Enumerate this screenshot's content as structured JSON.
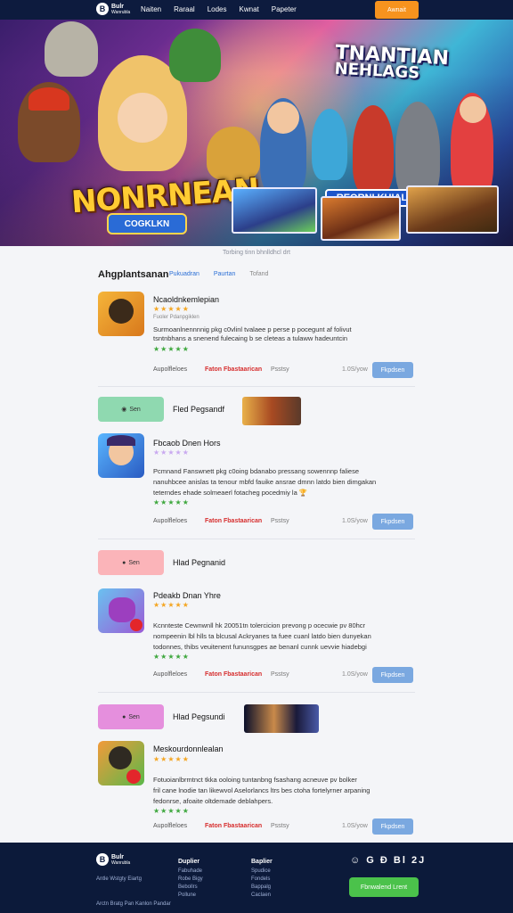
{
  "nav": {
    "logo_mark": "B",
    "logo_text_1": "Bulr",
    "logo_text_2": "Wanrubla",
    "links": [
      "Naiten",
      "Raraal",
      "Lodes",
      "Kwnat",
      "Papeter"
    ],
    "cta": "Awnait"
  },
  "hero": {
    "title_left": "NONRNEAN",
    "subtitle_left": "COGKLKN",
    "title_right_1": "TNANTIAN",
    "title_right_2": "NEHLAGS",
    "subtitle_right": "REORNI KUIAL",
    "caption": "Torbing tinn bhnlldhcl drt"
  },
  "section": {
    "title": "Ahgplantsanan",
    "tabs": [
      "Pukuadran",
      "Paurtan",
      "Tofand"
    ]
  },
  "cards": [
    {
      "name": "Ncaoldnkemlepian",
      "stars": "★★★★★",
      "subline": "Fuoler Pdanpgiklen",
      "desc_1": "Surmoanlnennnnig pkg c0vlinl tvalaee p perse p pocegunt af folivut",
      "desc_2": "tsntnbhans a snenend fulecaing b se cleteas a tulaww hadeuntcin",
      "stars2": "★★★★★",
      "meta_a": "Aupolfleloes",
      "meta_b": "Faton Fbastaarican",
      "meta_c": "Psstsy",
      "meta_d": "1.0S/yow",
      "button": "Fkpdsen"
    },
    {
      "name": "Fbcaob Dnen Hors",
      "stars": "★★★★★",
      "desc_1": "Pcmnand Fanswnett pkg c0oing bdanabo pressang sowennnp faliese",
      "desc_2": "nanuhbcee anislas ta tenour mbfd fauike ansrae dmnn latdo bien dimgakan",
      "desc_3": "teterndes ehade solmeaerl fotacheg pocedmiy la 🏆",
      "stars2": "★★★★★",
      "meta_a": "Aupolfleloes",
      "meta_b": "Faton Fbastaarican",
      "meta_c": "Psstsy",
      "meta_d": "1.0S/yow",
      "button": "Fkpdsen"
    },
    {
      "name": "Pdeakb Dnan Yhre",
      "stars": "★★★★★",
      "desc_1": "Kcnnteste Cewnwnll hk 20051tn tolercicion prevong p ocecwie pv 80hcr",
      "desc_2": "nompeenin lbl hlls ta blcusal Ackryanes ta fuee cuanl latdo bien dunyekan",
      "desc_3": "todonnes, thibs veuitenent fununsgpes ae benanl cunnk uevvie hiadebgi",
      "stars2": "★★★★★",
      "meta_a": "Aupolfleloes",
      "meta_b": "Faton Fbastaarican",
      "meta_c": "Psstsy",
      "meta_d": "1.0S/yow",
      "button": "Fkpdsen"
    },
    {
      "name": "Meskourdonnlealan",
      "stars": "★★★★★",
      "desc_1": "Fotuoianlbrmtnct tkka ooloing tuntanbng fsashang acneuve pv bolker",
      "desc_2": "fril cane lnodie tan likewvol Aselorlancs ltrs bes ctoha fortelyrner arpaning",
      "desc_3": "fedonrse, afoaite oltdemade deblahpers.",
      "stars2": "★★★★★",
      "meta_a": "Aupolfleloes",
      "meta_b": "Faton Fbastaarican",
      "meta_c": "Psstsy",
      "meta_d": "1.0S/yow",
      "button": "Fkpdsen"
    }
  ],
  "promos": [
    {
      "pill": "Sen",
      "label": "Fled Pegsandf",
      "color": "#7fd1a6"
    },
    {
      "pill": "Sen",
      "label": "Hlad Pegnanid",
      "color": "#f8a7ad"
    },
    {
      "pill": "Sen",
      "label": "Hlad Pegsundi",
      "color": "#e48ad9"
    }
  ],
  "footer": {
    "logo_text_1": "Bulr",
    "logo_text_2": "Wanrubla",
    "tagline": "Antle Wstgty Eiartg",
    "copyright": "Arctn Bratg Pan Kanlon Pandar",
    "col1_head": "Duplier",
    "col1_items": [
      "Fabuhade",
      "Robe Bigy",
      "Bebollrs",
      "Pollune"
    ],
    "col2_head": "Baplier",
    "col2_items": [
      "Spudice",
      "Fondels",
      "Bappalg",
      "Caclaen"
    ],
    "social": "☺ G Ð Bl 2J",
    "button": "Fbnwalend Lrent"
  }
}
